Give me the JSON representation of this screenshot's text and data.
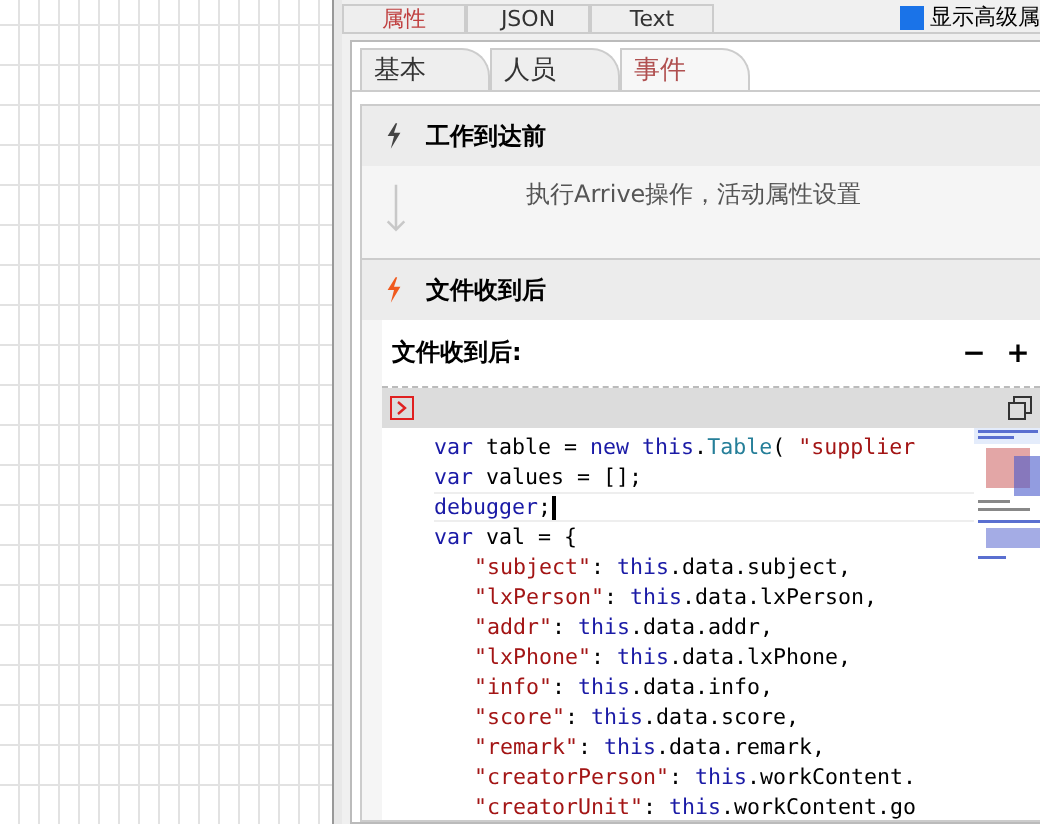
{
  "top_tabs": [
    {
      "label": "属性",
      "selected": true
    },
    {
      "label": "JSON",
      "selected": false
    },
    {
      "label": "Text",
      "selected": false
    }
  ],
  "advanced_toggle": {
    "label": "显示高级属",
    "checked": true
  },
  "sub_tabs": [
    {
      "label": "基本",
      "selected": false
    },
    {
      "label": "人员",
      "selected": false
    },
    {
      "label": "事件",
      "selected": true
    }
  ],
  "events": [
    {
      "kind": "summary",
      "title": "工作到达前",
      "active": false,
      "description": "执行Arrive操作，活动属性设置"
    },
    {
      "kind": "editor",
      "title": "文件收到后",
      "active": true,
      "label": "文件收到后:",
      "collapse_button": "−",
      "expand_button": "+"
    }
  ],
  "code_lines": [
    {
      "current": false,
      "tokens": [
        {
          "kind": "kw",
          "text": "var"
        },
        {
          "kind": "plain",
          "text": " table = "
        },
        {
          "kind": "kw",
          "text": "new this"
        },
        {
          "kind": "plain",
          "text": "."
        },
        {
          "kind": "type",
          "text": "Table"
        },
        {
          "kind": "plain",
          "text": "( "
        },
        {
          "kind": "str",
          "text": "\"supplier"
        }
      ]
    },
    {
      "current": false,
      "tokens": [
        {
          "kind": "kw",
          "text": "var"
        },
        {
          "kind": "plain",
          "text": " values = [];"
        }
      ]
    },
    {
      "current": true,
      "tokens": [
        {
          "kind": "kw",
          "text": "debugger"
        },
        {
          "kind": "plain",
          "text": ";"
        }
      ]
    },
    {
      "current": false,
      "tokens": [
        {
          "kind": "kw",
          "text": "var"
        },
        {
          "kind": "plain",
          "text": " val = {"
        }
      ],
      "children": [
        {
          "current": false,
          "tokens": [
            {
              "kind": "str",
              "text": "\"subject\""
            },
            {
              "kind": "plain",
              "text": ": "
            },
            {
              "kind": "kw",
              "text": "this"
            },
            {
              "kind": "plain",
              "text": ".data.subject,"
            }
          ]
        },
        {
          "current": false,
          "tokens": [
            {
              "kind": "str",
              "text": "\"lxPerson\""
            },
            {
              "kind": "plain",
              "text": ": "
            },
            {
              "kind": "kw",
              "text": "this"
            },
            {
              "kind": "plain",
              "text": ".data.lxPerson,"
            }
          ]
        },
        {
          "current": false,
          "tokens": [
            {
              "kind": "str",
              "text": "\"addr\""
            },
            {
              "kind": "plain",
              "text": ": "
            },
            {
              "kind": "kw",
              "text": "this"
            },
            {
              "kind": "plain",
              "text": ".data.addr,"
            }
          ]
        },
        {
          "current": false,
          "tokens": [
            {
              "kind": "str",
              "text": "\"lxPhone\""
            },
            {
              "kind": "plain",
              "text": ": "
            },
            {
              "kind": "kw",
              "text": "this"
            },
            {
              "kind": "plain",
              "text": ".data.lxPhone,"
            }
          ]
        },
        {
          "current": false,
          "tokens": [
            {
              "kind": "str",
              "text": "\"info\""
            },
            {
              "kind": "plain",
              "text": ": "
            },
            {
              "kind": "kw",
              "text": "this"
            },
            {
              "kind": "plain",
              "text": ".data.info,"
            }
          ]
        },
        {
          "current": false,
          "tokens": [
            {
              "kind": "str",
              "text": "\"score\""
            },
            {
              "kind": "plain",
              "text": ": "
            },
            {
              "kind": "kw",
              "text": "this"
            },
            {
              "kind": "plain",
              "text": ".data.score,"
            }
          ]
        },
        {
          "current": false,
          "tokens": [
            {
              "kind": "str",
              "text": "\"remark\""
            },
            {
              "kind": "plain",
              "text": ": "
            },
            {
              "kind": "kw",
              "text": "this"
            },
            {
              "kind": "plain",
              "text": ".data.remark,"
            }
          ]
        },
        {
          "current": false,
          "tokens": [
            {
              "kind": "str",
              "text": "\"creatorPerson\""
            },
            {
              "kind": "plain",
              "text": ": "
            },
            {
              "kind": "kw",
              "text": "this"
            },
            {
              "kind": "plain",
              "text": ".workContent."
            }
          ]
        },
        {
          "current": false,
          "tokens": [
            {
              "kind": "str",
              "text": "\"creatorUnit\""
            },
            {
              "kind": "plain",
              "text": ": "
            },
            {
              "kind": "kw",
              "text": "this"
            },
            {
              "kind": "plain",
              "text": ".workContent.go"
            }
          ]
        }
      ]
    }
  ]
}
